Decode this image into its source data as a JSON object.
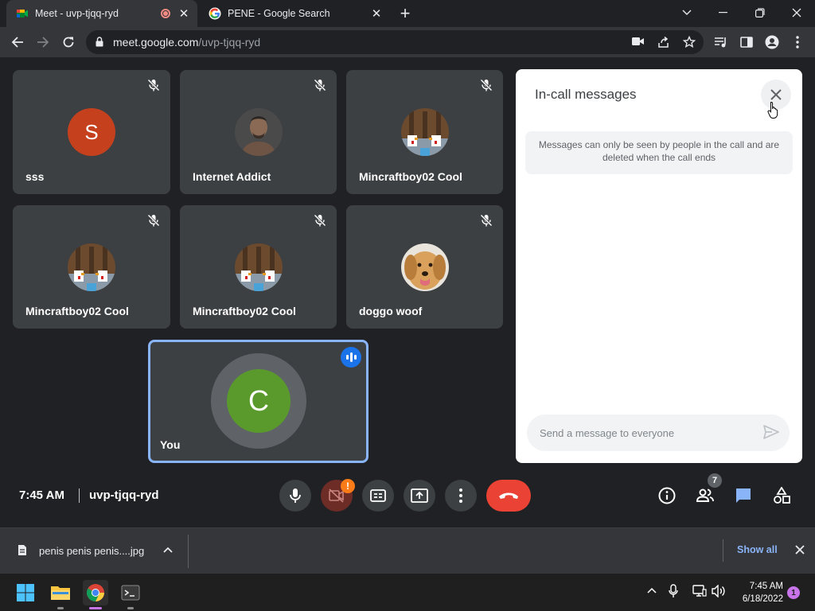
{
  "browser": {
    "tabs": [
      {
        "title": "Meet - uvp-tjqq-ryd",
        "active": true,
        "recording": true
      },
      {
        "title": "PENE - Google Search",
        "active": false
      }
    ],
    "url_host": "meet.google.com",
    "url_path": "/uvp-tjqq-ryd"
  },
  "meet": {
    "participants": [
      {
        "name": "sss",
        "avatar": "letter",
        "letter": "S",
        "color": "#c5411e",
        "muted": true
      },
      {
        "name": "Internet Addict",
        "avatar": "photo-man",
        "muted": true
      },
      {
        "name": "Mincraftboy02 Cool",
        "avatar": "photo-chickens",
        "muted": true
      },
      {
        "name": "Mincraftboy02 Cool",
        "avatar": "photo-chickens",
        "muted": true
      },
      {
        "name": "Mincraftboy02 Cool",
        "avatar": "photo-chickens",
        "muted": true
      },
      {
        "name": "doggo woof",
        "avatar": "photo-dog",
        "muted": true
      }
    ],
    "self": {
      "name": "You",
      "letter": "C",
      "color": "#5a9a2c",
      "speaking": true
    },
    "chat": {
      "title": "In-call messages",
      "notice": "Messages can only be seen by people in the call and are deleted when the call ends",
      "placeholder": "Send a message to everyone"
    },
    "footer": {
      "time": "7:45 AM",
      "meeting_code": "uvp-tjqq-ryd",
      "camera_warning": "!",
      "participant_count": "7"
    }
  },
  "downloads": {
    "file_name": "penis penis penis....jpg",
    "show_all_label": "Show all"
  },
  "taskbar": {
    "time": "7:45 AM",
    "date": "6/18/2022",
    "notification_count": "1"
  }
}
